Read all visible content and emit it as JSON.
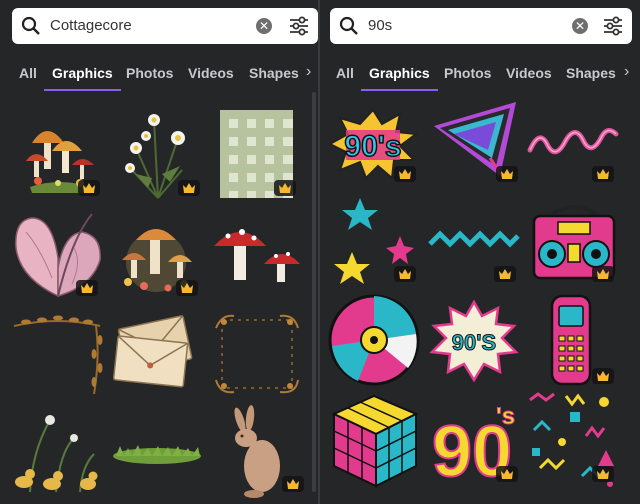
{
  "left": {
    "search": {
      "value": "Cottagecore"
    },
    "tabs": [
      "All",
      "Graphics",
      "Photos",
      "Videos",
      "Shapes"
    ],
    "active_tab": "Graphics",
    "items": [
      {
        "name": "mushroom-cluster"
      },
      {
        "name": "chamomile-bouquet"
      },
      {
        "name": "gingham-pattern"
      },
      {
        "name": "pink-butterfly-wing"
      },
      {
        "name": "mushroom-flowers"
      },
      {
        "name": "red-mushrooms"
      },
      {
        "name": "leaf-vine-frame"
      },
      {
        "name": "envelopes"
      },
      {
        "name": "floral-frame"
      },
      {
        "name": "ducklings-flowers"
      },
      {
        "name": "grass-patch"
      },
      {
        "name": "bunny"
      }
    ]
  },
  "right": {
    "search": {
      "value": "90s"
    },
    "tabs": [
      "All",
      "Graphics",
      "Photos",
      "Videos",
      "Shapes"
    ],
    "active_tab": "Graphics",
    "items": [
      {
        "name": "90s-burst-text",
        "text": "90's"
      },
      {
        "name": "neon-triangle"
      },
      {
        "name": "pink-squiggle"
      },
      {
        "name": "star-shapes"
      },
      {
        "name": "teal-zigzag"
      },
      {
        "name": "boombox"
      },
      {
        "name": "cd-disc"
      },
      {
        "name": "90s-badge",
        "text": "90'S"
      },
      {
        "name": "retro-phone"
      },
      {
        "name": "rubiks-cube"
      },
      {
        "name": "90s-yellow-text",
        "text": "90",
        "sup": "'s"
      },
      {
        "name": "memphis-pattern"
      }
    ]
  },
  "colors": {
    "accent": "#8b5cf6",
    "panel": "#252627",
    "tab_text": "#c8c9cc"
  },
  "icons": {
    "search": "search-icon",
    "clear": "clear-icon",
    "filter": "filter-icon",
    "premium": "crown-icon",
    "more": "chevron-right-icon"
  }
}
